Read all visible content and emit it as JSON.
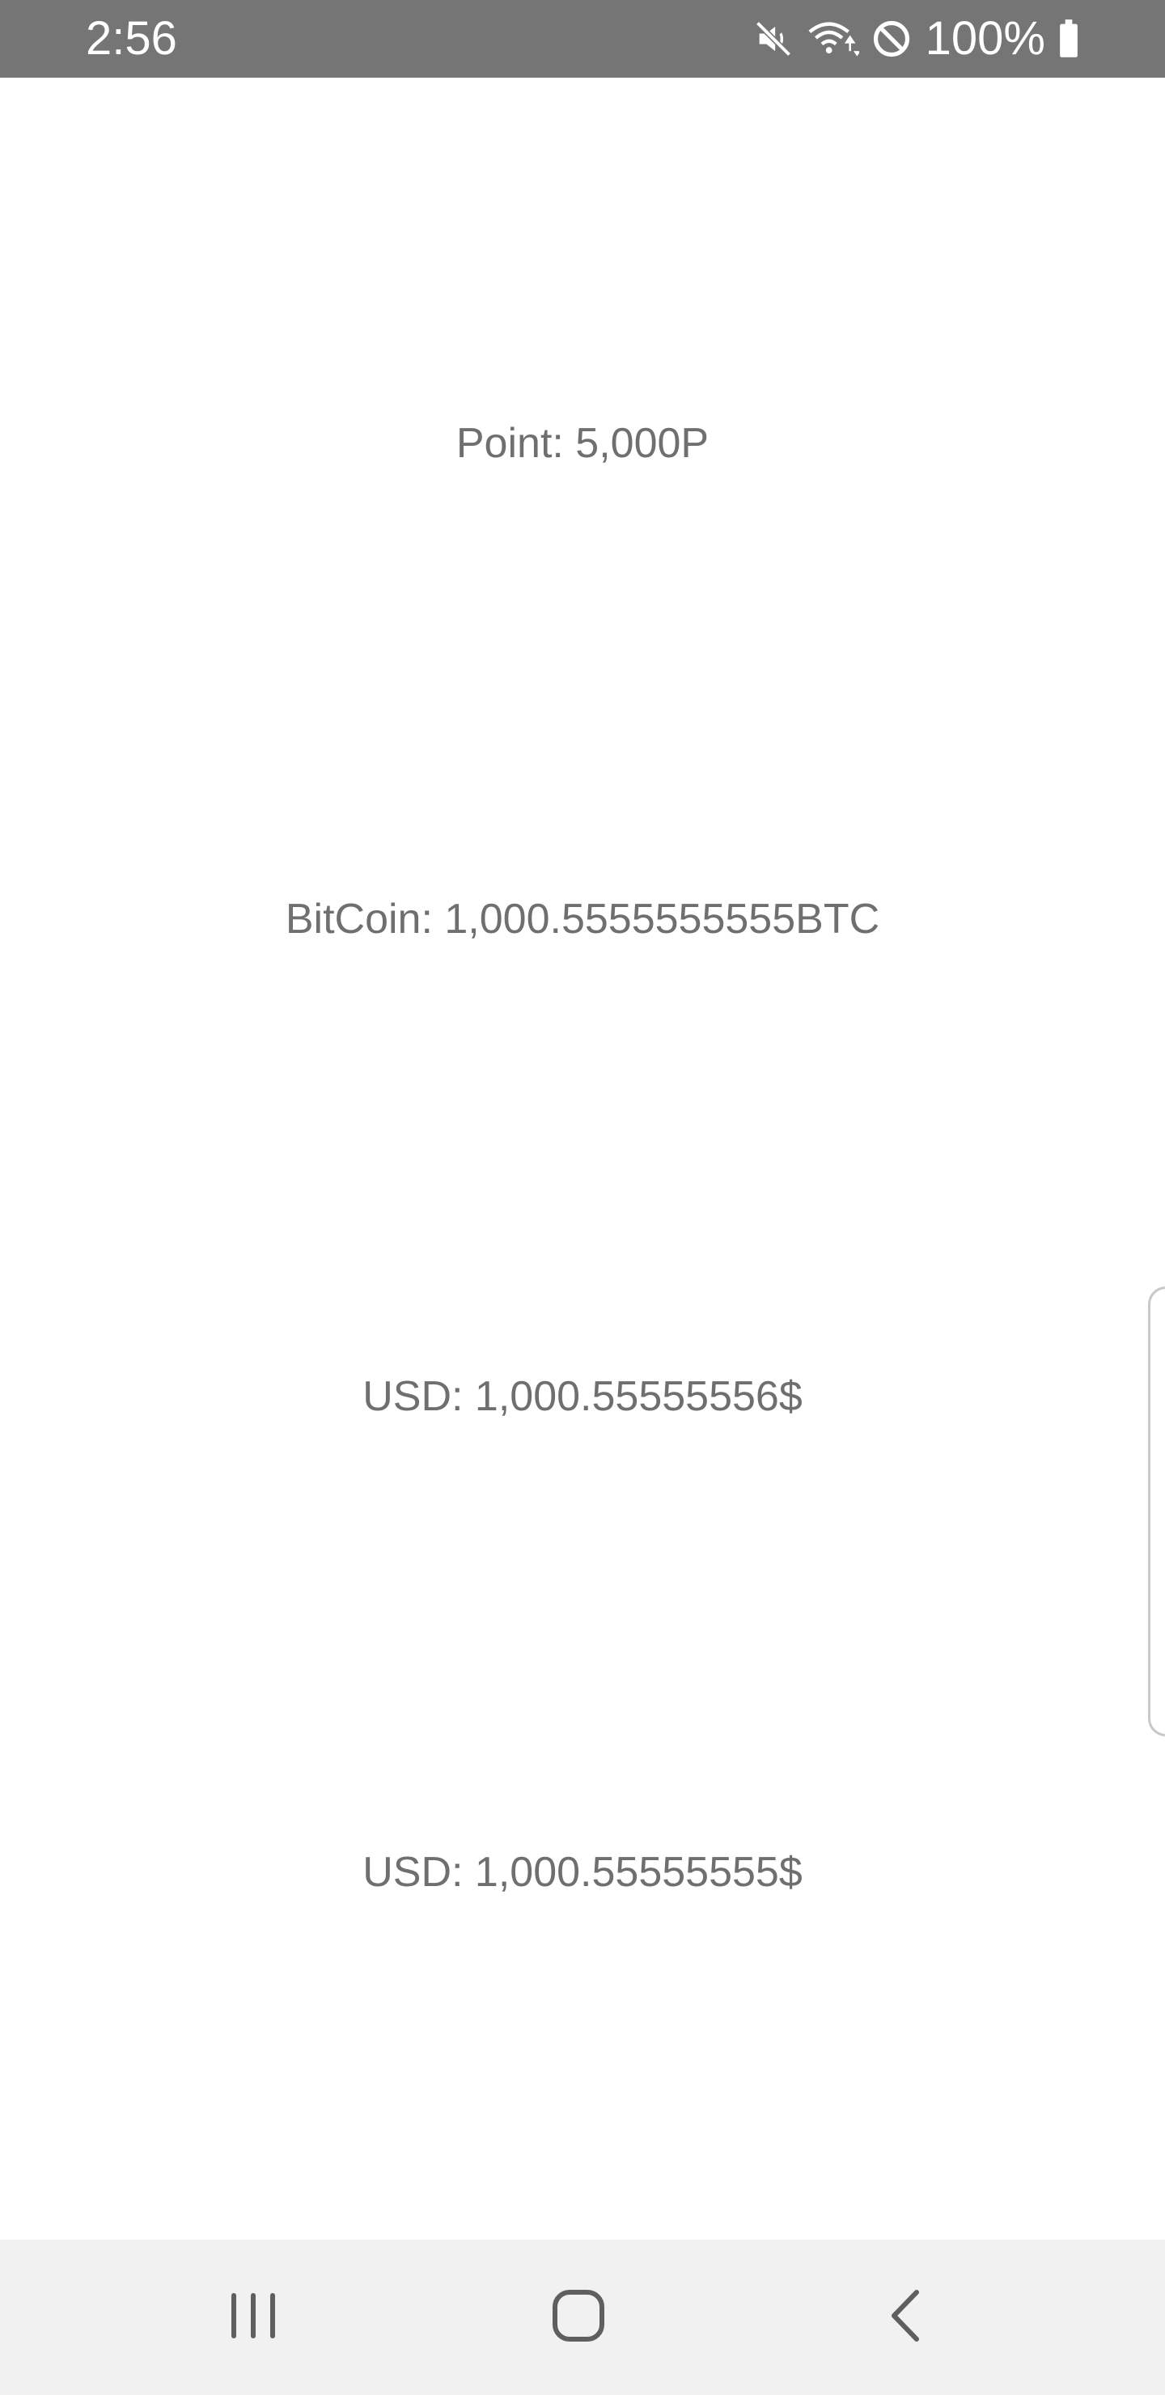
{
  "status_bar": {
    "time": "2:56",
    "battery_percent": "100%",
    "icons": [
      "mute-icon",
      "wifi-icon",
      "block-icon",
      "battery-icon"
    ]
  },
  "main": {
    "point_line": "Point: 5,000P",
    "bitcoin_line": "BitCoin: 1,000.5555555555BTC",
    "usd_line_1": "USD: 1,000.55555556$",
    "usd_line_2": "USD: 1,000.55555555$"
  },
  "nav_bar": {
    "icons": [
      "recents-icon",
      "home-icon",
      "back-icon"
    ]
  },
  "colors": {
    "status_bar_bg": "#757575",
    "text": "#6f6f6f",
    "nav_bar_bg": "#f1f1f1"
  }
}
